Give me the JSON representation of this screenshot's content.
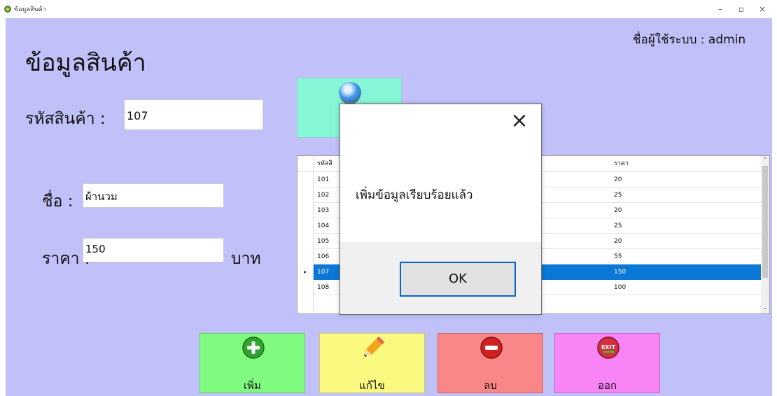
{
  "window": {
    "title": "ข้อมูลสินค้า",
    "minimize": "–",
    "maximize": "▫",
    "close": "×"
  },
  "header": {
    "title": "ข้อมูลสินค้า",
    "user_label": "ชื่อผู้ใช้ระบบ : admin"
  },
  "form": {
    "code_label": "รหัสสินค้า :",
    "code_value": "107",
    "name_label": "ชื่อ :",
    "name_value": "ผ้านวม",
    "price_label": "ราคา :",
    "price_value": "150",
    "price_unit": "บาท"
  },
  "grid": {
    "columns": [
      "รหัสสิ",
      "ราคา"
    ],
    "rows": [
      {
        "code": "101",
        "price": "20"
      },
      {
        "code": "102",
        "price": "25"
      },
      {
        "code": "103",
        "price": "20"
      },
      {
        "code": "104",
        "price": "25"
      },
      {
        "code": "105",
        "price": "20"
      },
      {
        "code": "106",
        "price": "55"
      },
      {
        "code": "107",
        "price": "150",
        "selected": true
      },
      {
        "code": "108",
        "price": "100"
      }
    ],
    "row_selector_glyph": "▸",
    "scroll_up": "⌃",
    "scroll_down": "⌄"
  },
  "buttons": {
    "add": "เพิ่ม",
    "edit": "แก้ไข",
    "delete": "ลบ",
    "exit": "ออก",
    "exit_icon_text": "EXIT"
  },
  "dialog": {
    "message": "เพิ่มข้อมูลเรียบร้อยแล้ว",
    "ok": "OK",
    "close": "×"
  },
  "colors": {
    "background": "#c1c1fa",
    "search": "#86f7d6",
    "add": "#80fb80",
    "edit": "#fafa80",
    "delete": "#f98787",
    "exit": "#f884f6",
    "selection": "#0b78d7"
  }
}
